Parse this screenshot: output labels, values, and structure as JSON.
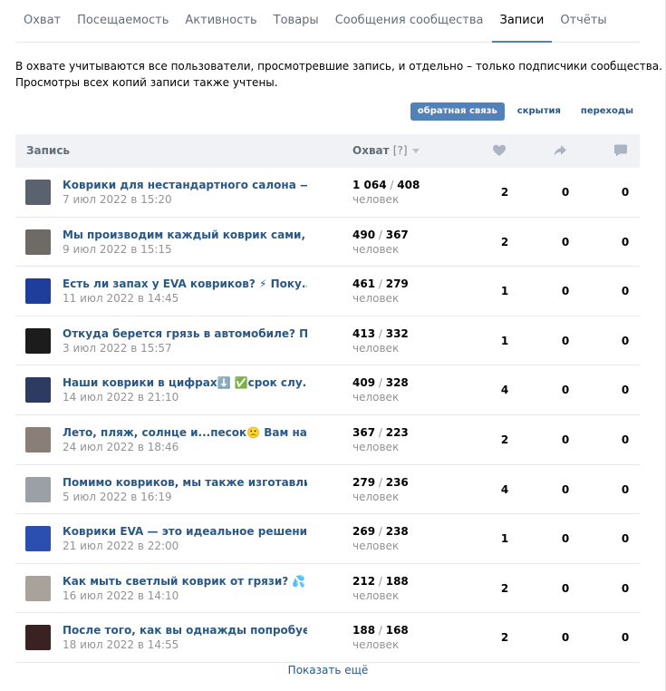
{
  "tabs": [
    {
      "label": "Охват",
      "active": false
    },
    {
      "label": "Посещаемость",
      "active": false
    },
    {
      "label": "Активность",
      "active": false
    },
    {
      "label": "Товары",
      "active": false
    },
    {
      "label": "Сообщения сообщества",
      "active": false
    },
    {
      "label": "Записи",
      "active": true
    },
    {
      "label": "Отчёты",
      "active": false
    }
  ],
  "description": {
    "line1": "В охвате учитываются все пользователи, просмотревшие запись, и отдельно – только подписчики сообщества.",
    "line2": "Просмотры всех копий записи также учтены."
  },
  "filters": [
    {
      "label": "обратная связь",
      "active": true
    },
    {
      "label": "скрытия",
      "active": false
    },
    {
      "label": "переходы",
      "active": false
    }
  ],
  "table": {
    "col_post": "Запись",
    "col_reach": "Охват",
    "col_reach_help": "[?]",
    "icons": {
      "likes": "heart-icon",
      "shares": "share-icon",
      "comments": "comment-icon"
    },
    "people_label": "человек",
    "rows": [
      {
        "title": "Коврики для нестандартного салона — л...",
        "date": "7 июл 2022 в 15:20",
        "reach_total": "1 064",
        "reach_subs": "408",
        "likes": "2",
        "shares": "0",
        "comments": "0",
        "thumb": "#5a6270"
      },
      {
        "title": "Мы производим каждый коврик сами, ...",
        "date": "9 июл 2022 в 15:15",
        "reach_total": "490",
        "reach_subs": "367",
        "likes": "2",
        "shares": "0",
        "comments": "0",
        "thumb": "#6e6a66"
      },
      {
        "title": "Есть ли запах у EVA ковриков? ⚡ Поку...",
        "date": "11 июл 2022 в 14:45",
        "reach_total": "461",
        "reach_subs": "279",
        "likes": "1",
        "shares": "0",
        "comments": "0",
        "thumb": "#1f3e9c"
      },
      {
        "title": "Откуда берется грязь в автомобиле? П...",
        "date": "3 июл 2022 в 15:57",
        "reach_total": "413",
        "reach_subs": "332",
        "likes": "1",
        "shares": "0",
        "comments": "0",
        "thumb": "#1c1c1c"
      },
      {
        "title": "Наши коврики в цифрах⬇️ ✅срок слу...",
        "date": "14 июл 2022 в 21:10",
        "reach_total": "409",
        "reach_subs": "328",
        "likes": "4",
        "shares": "0",
        "comments": "0",
        "thumb": "#2d3b63"
      },
      {
        "title": "Лето, пляж, солнце и...песок🙁 Вам нав...",
        "date": "24 июл 2022 в 18:46",
        "reach_total": "367",
        "reach_subs": "223",
        "likes": "2",
        "shares": "0",
        "comments": "0",
        "thumb": "#8a7f78"
      },
      {
        "title": "Помимо ковриков, мы также изготавли...",
        "date": "5 июл 2022 в 16:19",
        "reach_total": "279",
        "reach_subs": "236",
        "likes": "4",
        "shares": "0",
        "comments": "0",
        "thumb": "#9aa0a6"
      },
      {
        "title": "Коврики EVA — это идеальное решение...",
        "date": "21 июл 2022 в 22:00",
        "reach_total": "269",
        "reach_subs": "238",
        "likes": "1",
        "shares": "0",
        "comments": "0",
        "thumb": "#2b4fb0"
      },
      {
        "title": "Как мыть светлый коврик от грязи? 💦 ...",
        "date": "16 июл 2022 в 14:10",
        "reach_total": "212",
        "reach_subs": "188",
        "likes": "2",
        "shares": "0",
        "comments": "0",
        "thumb": "#a8a29a"
      },
      {
        "title": "После того, как вы однажды попробует...",
        "date": "18 июл 2022 в 14:55",
        "reach_total": "188",
        "reach_subs": "168",
        "likes": "2",
        "shares": "0",
        "comments": "0",
        "thumb": "#3a2222"
      }
    ]
  },
  "show_more": "Показать ещё",
  "colors": {
    "accent": "#5181b8",
    "link": "#2a5885",
    "muted": "#939393",
    "header_bg": "#f0f2f5",
    "border": "#e7e8ec"
  }
}
